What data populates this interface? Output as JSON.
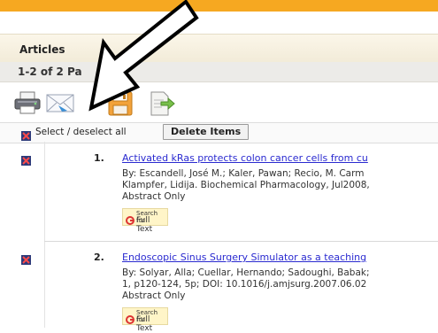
{
  "header": {
    "title": "Articles"
  },
  "results": {
    "count_text": "1-2 of 2 Pa"
  },
  "toolbar": {
    "icons": [
      "printer-icon",
      "email-icon",
      "save-icon",
      "export-icon"
    ],
    "select_all_label": "Select / deselect all",
    "delete_label": "Delete Items"
  },
  "items": [
    {
      "number": "1.",
      "title": "Activated kRas protects colon cancer cells from cu",
      "meta_line1": "By: Escandell, José M.; Kaler, Pawan; Recio, M. Carm",
      "meta_line2": "Klampfer, Lidija. Biochemical Pharmacology, Jul2008,",
      "meta_line3": "Abstract Only",
      "fulltext_small": "Search for",
      "fulltext_big": "Full Text"
    },
    {
      "number": "2.",
      "title": "Endoscopic Sinus Surgery Simulator as a teaching",
      "meta_line1": "By: Solyar, Alla; Cuellar, Hernando; Sadoughi, Babak;",
      "meta_line2": "1, p120-124, 5p; DOI: 10.1016/j.amjsurg.2007.06.02",
      "meta_line3": "Abstract Only",
      "fulltext_small": "Search for",
      "fulltext_big": "Full Text"
    }
  ],
  "colors": {
    "accent_bar": "#f6a821",
    "link": "#2a2ad0",
    "fulltext_bg": "#fff5c8"
  }
}
